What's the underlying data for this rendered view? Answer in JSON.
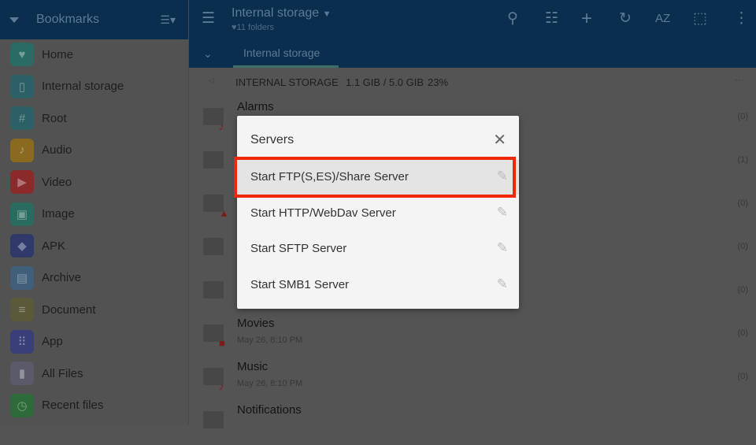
{
  "sidebar": {
    "title": "Bookmarks",
    "items": [
      {
        "label": "Home",
        "icon": "heart-icon",
        "color": "#2a6b63"
      },
      {
        "label": "Internal storage",
        "icon": "tablet-icon",
        "color": "#2d5f66"
      },
      {
        "label": "Root",
        "icon": "hash-icon",
        "color": "#2d5f66"
      },
      {
        "label": "Audio",
        "icon": "music-icon",
        "color": "#8a6a1f"
      },
      {
        "label": "Video",
        "icon": "play-icon",
        "color": "#8a2a2a"
      },
      {
        "label": "Image",
        "icon": "image-icon",
        "color": "#2a6b5f"
      },
      {
        "label": "APK",
        "icon": "android-icon",
        "color": "#2f3a6b"
      },
      {
        "label": "Archive",
        "icon": "archive-icon",
        "color": "#3f5f7a"
      },
      {
        "label": "Document",
        "icon": "document-icon",
        "color": "#5a5a3a"
      },
      {
        "label": "App",
        "icon": "grid-icon",
        "color": "#3a3f7a"
      },
      {
        "label": "All Files",
        "icon": "file-icon",
        "color": "#5a5a6a"
      },
      {
        "label": "Recent files",
        "icon": "clock-icon",
        "color": "#2f6b3a"
      }
    ]
  },
  "header": {
    "title": "Internal storage",
    "subtitle": "11 folders",
    "tab": "Internal storage",
    "sort_label": "AZ"
  },
  "path": {
    "name": "INTERNAL STORAGE",
    "usage": "1.1 GIB / 5.0 GIB",
    "percent": "23%"
  },
  "files": [
    {
      "name": "Alarms",
      "date": "",
      "count": "(0)",
      "badge": "♪"
    },
    {
      "name": "",
      "date": "",
      "count": "(1)",
      "badge": ""
    },
    {
      "name": "",
      "date": "",
      "count": "(0)",
      "badge": "▲"
    },
    {
      "name": "",
      "date": "",
      "count": "(0)",
      "badge": ""
    },
    {
      "name": "",
      "date": "",
      "count": "(0)",
      "badge": ""
    },
    {
      "name": "Movies",
      "date": "May 26, 8:10 PM",
      "count": "(0)",
      "badge": "■"
    },
    {
      "name": "Music",
      "date": "May 26, 8:10 PM",
      "count": "(0)",
      "badge": "♪"
    },
    {
      "name": "Notifications",
      "date": "",
      "count": "",
      "badge": ""
    }
  ],
  "dialog": {
    "title": "Servers",
    "options": [
      "Start FTP(S,ES)/Share Server",
      "Start HTTP/WebDav Server",
      "Start SFTP Server",
      "Start SMB1 Server"
    ],
    "selected": 0,
    "highlight_color": "#f0280a"
  }
}
